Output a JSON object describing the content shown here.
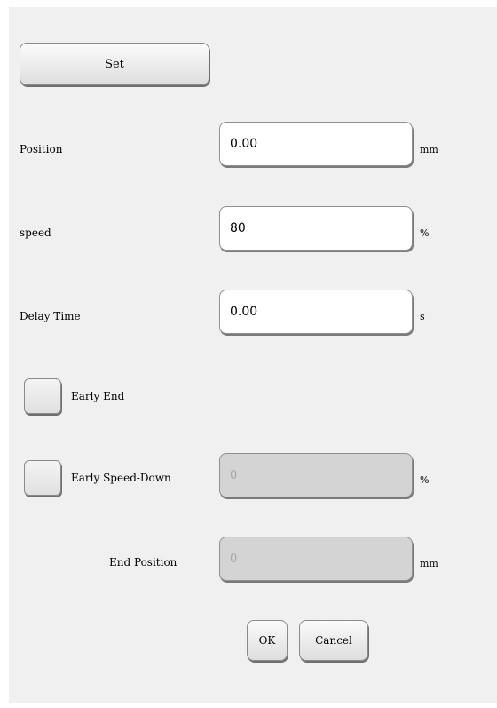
{
  "set_button": {
    "label": "Set"
  },
  "fields": {
    "position": {
      "label": "Position",
      "value": "0.00",
      "unit": "mm"
    },
    "speed": {
      "label": "speed",
      "value": "80",
      "unit": "%"
    },
    "delay_time": {
      "label": "Delay Time",
      "value": "0.00",
      "unit": "s"
    }
  },
  "early_end": {
    "label": "Early End",
    "checked": false
  },
  "early_speed_down": {
    "label": "Early Speed-Down",
    "checked": false,
    "value": "0",
    "unit": "%"
  },
  "end_position": {
    "label": "End Position",
    "value": "0",
    "unit": "mm"
  },
  "footer": {
    "ok_label": "OK",
    "cancel_label": "Cancel"
  }
}
